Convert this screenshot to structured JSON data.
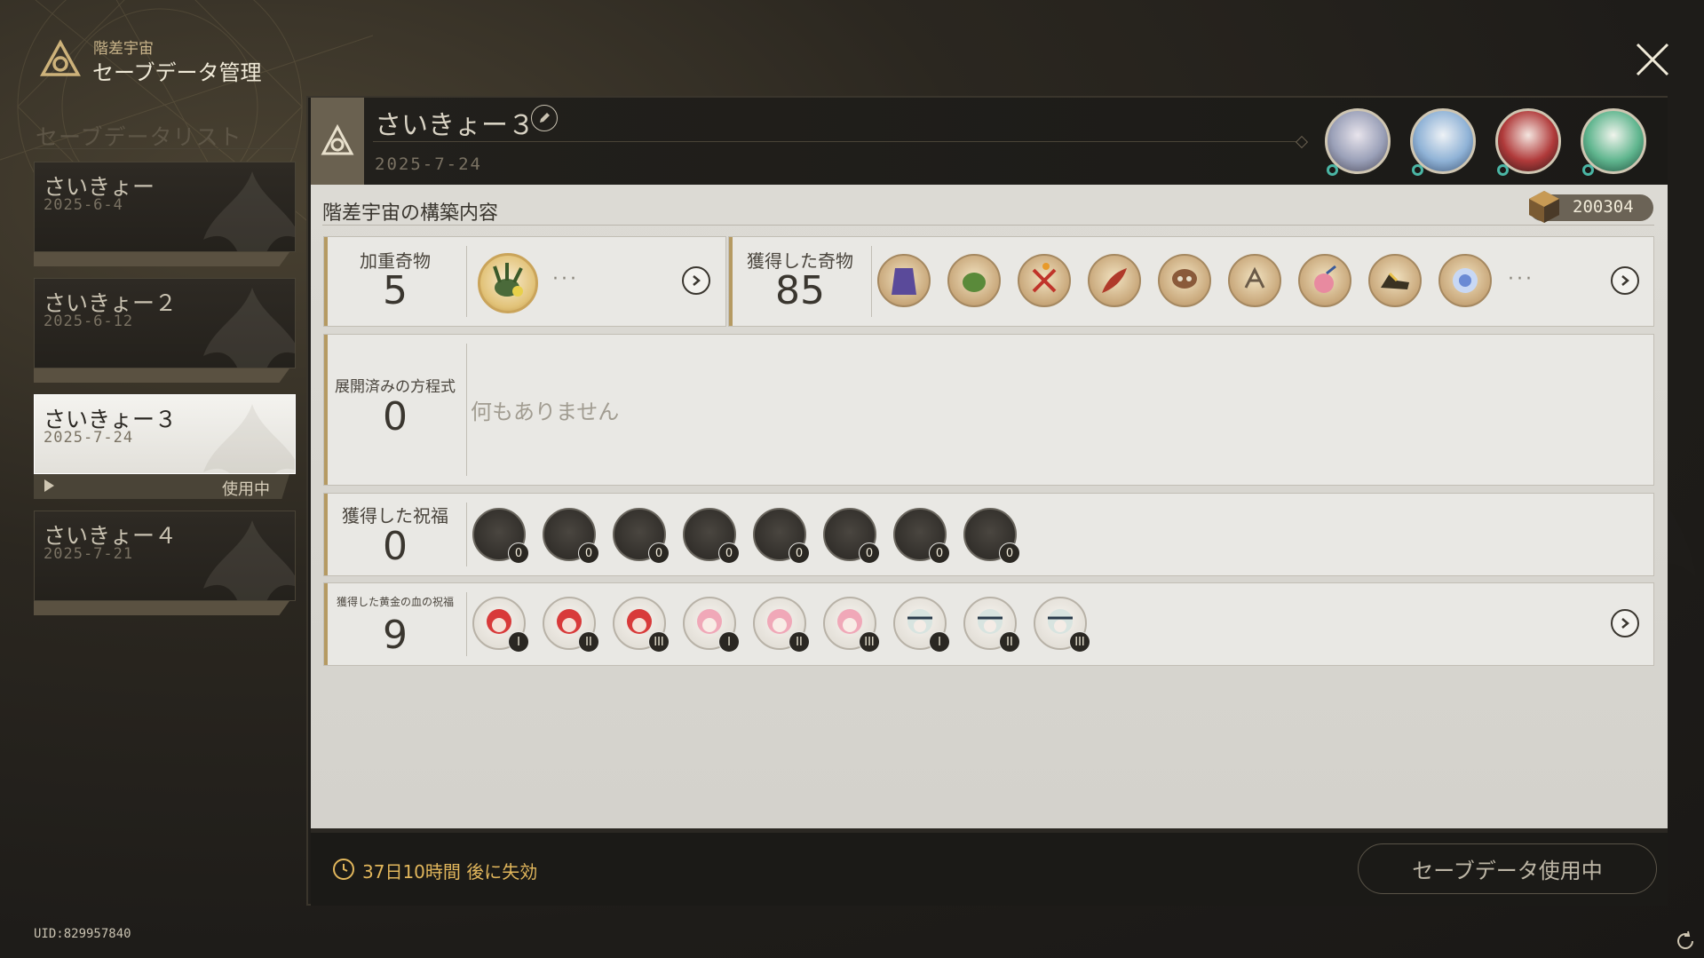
{
  "header": {
    "subtitle": "階差宇宙",
    "title": "セーブデータ管理"
  },
  "sidebar": {
    "title": "セーブデータリスト",
    "saves": [
      {
        "name": "さいきょー",
        "date": "2025-6-4"
      },
      {
        "name": "さいきょー２",
        "date": "2025-6-12"
      },
      {
        "name": "さいきょー３",
        "date": "2025-7-24",
        "status": "使用中"
      },
      {
        "name": "さいきょー４",
        "date": "2025-7-21"
      }
    ]
  },
  "uid": "UID:829957840",
  "detail": {
    "name": "さいきょー３",
    "date": "2025-7-24",
    "section_title": "階差宇宙の構築内容",
    "points": "200304",
    "weighted_curio": {
      "label": "加重奇物",
      "count": "5",
      "more": "···"
    },
    "obtained_curio": {
      "label": "獲得した奇物",
      "count": "85",
      "more": "···"
    },
    "equations": {
      "label": "展開済みの方程式",
      "count": "0",
      "empty": "何もありません"
    },
    "blessings": {
      "label": "獲得した祝福",
      "count": "0",
      "counts": [
        "0",
        "0",
        "0",
        "0",
        "0",
        "0",
        "0",
        "0"
      ]
    },
    "golden_blood": {
      "label": "獲得した黄金の血の祝福",
      "count": "9",
      "levels": [
        "I",
        "II",
        "III",
        "I",
        "II",
        "III",
        "I",
        "II",
        "III"
      ]
    }
  },
  "footer": {
    "expire": "37日10時間 後に失効",
    "button": "セーブデータ使用中"
  },
  "colors": {
    "accent": "#b59a62",
    "expire": "#e2b75c",
    "teal": "#4ab5a4"
  }
}
